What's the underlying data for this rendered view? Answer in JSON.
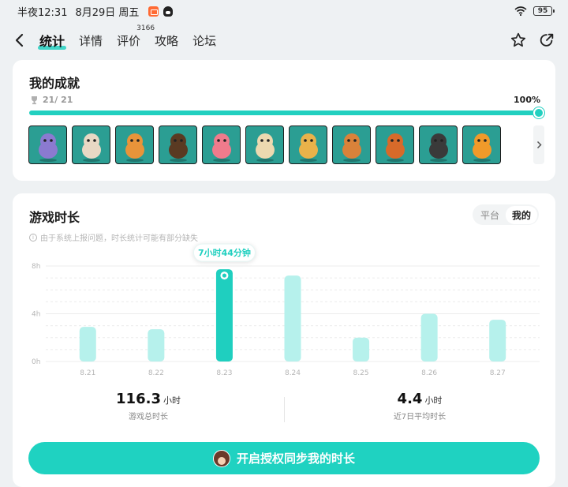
{
  "status_bar": {
    "time_text": "半夜12:31",
    "date_text": "8月29日 周五",
    "battery": "95"
  },
  "nav": {
    "tabs": [
      {
        "label": "统计",
        "active": true
      },
      {
        "label": "详情",
        "active": false
      },
      {
        "label": "评价",
        "active": false,
        "count": "3166"
      },
      {
        "label": "攻略",
        "active": false
      },
      {
        "label": "论坛",
        "active": false
      }
    ],
    "icons": [
      "back-icon",
      "star-icon",
      "share-icon"
    ]
  },
  "achievements": {
    "title": "我的成就",
    "count_text": "21/ 21",
    "percent_text": "100%",
    "progress": 1.0,
    "badges": [
      {
        "name": "purple-creature",
        "color": "#8b7ad0"
      },
      {
        "name": "rabbit",
        "color": "#e8d8c4"
      },
      {
        "name": "hamster",
        "color": "#e8943a"
      },
      {
        "name": "owl",
        "color": "#5a3a22"
      },
      {
        "name": "flamingo",
        "color": "#ef7b8c"
      },
      {
        "name": "alpaca",
        "color": "#ecd9b0"
      },
      {
        "name": "giraffe",
        "color": "#e9b24a"
      },
      {
        "name": "deer",
        "color": "#d9823a"
      },
      {
        "name": "lion",
        "color": "#d76a2a"
      },
      {
        "name": "ostrich",
        "color": "#3a3a3a"
      },
      {
        "name": "tiger",
        "color": "#f09a2a"
      }
    ]
  },
  "playtime": {
    "title": "游戏时长",
    "toggle": {
      "options": [
        "平台",
        "我的"
      ],
      "selected": "我的"
    },
    "notice": "由于系统上报问题，时长统计可能有部分缺失",
    "stats": [
      {
        "value": "116.3",
        "unit": "小时",
        "label": "游戏总时长"
      },
      {
        "value": "4.4",
        "unit": "小时",
        "label": "近7日平均时长"
      }
    ],
    "cta_label": "开启授权同步我的时长"
  },
  "chart_data": {
    "type": "bar",
    "categories": [
      "8.21",
      "8.22",
      "8.23",
      "8.24",
      "8.25",
      "8.26",
      "8.27"
    ],
    "values": [
      2.9,
      2.7,
      7.73,
      7.2,
      2.0,
      4.0,
      3.5
    ],
    "y_ticks": [
      "0h",
      "4h",
      "8h"
    ],
    "ylim": [
      0,
      8
    ],
    "highlight_index": 2,
    "tooltip_text": "7小时44分钟",
    "colors": {
      "bar": "#b6f1ec",
      "highlight": "#1fcfbf"
    },
    "grid": true
  }
}
